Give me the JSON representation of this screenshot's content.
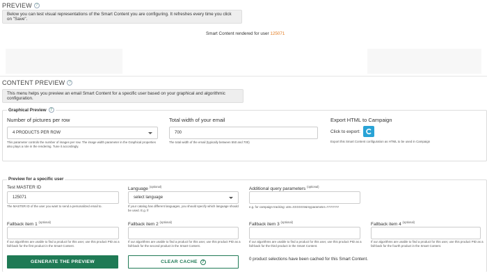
{
  "preview": {
    "title": "PREVIEW",
    "info": "Below you can test visual representations of the Smart Content you are configuring. It refreshes every time you click on \"Save\".",
    "rendered_prefix": "Smart Content rendered for user",
    "rendered_user": "125071"
  },
  "content_preview": {
    "title": "CONTENT PREVIEW",
    "info": "This menu helps you preview an email Smart Content for a specific user based on your graphical and algorithmic configuration."
  },
  "graphical": {
    "legend": "Graphical Preview",
    "pictures_label": "Number of pictures per row",
    "pictures_value": "4 PRODUCTS PER ROW",
    "pictures_hint": "This parameter controls the number of images per row. The image width parameter in the Graphical properties also plays a role in the rendering. Tune it accordingly.",
    "width_label": "Total width of your email",
    "width_value": "700",
    "width_hint": "The total width of the email (typically between 550 and 700)",
    "export_label": "Export HTML to Campaign",
    "click_label": "Click to export:",
    "export_hint": "Export this Smart Content configuration as HTML to be used in Campaign"
  },
  "specific": {
    "legend": "Preview for a specific user",
    "master_id_label": "Test MASTER ID",
    "master_id_value": "125071",
    "master_id_hint": "The MASTER ID of the user you want to send a personalized email to.",
    "language_label": "Language",
    "language_optional": "(optional)",
    "language_value": "select language",
    "language_hint": "If your catalog has different languages, you should specify which language should be used. E.g. fr",
    "query_label": "Additional query parameters",
    "query_optional": "(optional)",
    "query_hint": "e.g. for campaign tracking: utm=XXXXXX&myparameter=YYYYYY",
    "optional": "(optional)",
    "fallbacks": [
      {
        "label": "Fallback item 1",
        "hint": "If our algorithms are unable to find a product for this user, use this product PID as a fall-back for the first product in the Smart Content."
      },
      {
        "label": "Fallback item 2",
        "hint": "If our algorithms are unable to find a product for this user, use this product PID as a fall-back for the second product in the Smart Content."
      },
      {
        "label": "Fallback item 3",
        "hint": "If our algorithms are unable to find a product for this user, use this product PID as a fall-back for the third product in the Smart Content."
      },
      {
        "label": "Fallback item 4",
        "hint": "If our algorithms are unable to find a product for this user, use this product PID as a fall-back for the fourth product in the Smart Content."
      }
    ],
    "generate_label": "GENERATE THE PREVIEW",
    "clear_label": "CLEAR CACHE",
    "cached_text": "0 product selections have been cached for this Smart Content."
  },
  "icons": {
    "help": "help-circle-icon",
    "export": "campaign-export-icon",
    "dropdown": "chevron-down-icon"
  },
  "colors": {
    "primary": "#1f7a55",
    "user_highlight": "#e27a1e",
    "export_button": "#29a3d6"
  }
}
